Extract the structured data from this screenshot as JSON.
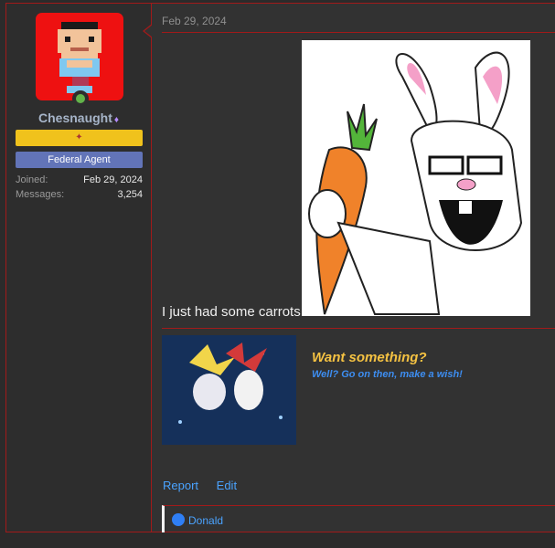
{
  "post": {
    "date": "Feb 29, 2024",
    "message": "I just had some carrots"
  },
  "user": {
    "name": "Chesnaught",
    "title_banner": "Federal Agent",
    "joined_label": "Joined:",
    "joined_value": "Feb 29, 2024",
    "messages_label": "Messages:",
    "messages_value": "3,254"
  },
  "signature": {
    "headline": "Want something?",
    "subline": "Well? Go on then, make a wish!"
  },
  "actions": {
    "report": "Report",
    "edit": "Edit"
  },
  "reactions": {
    "user": "Donald"
  },
  "colors": {
    "border": "#a11a1a",
    "link": "#4aa3ff",
    "avatar_bg": "#ee1111",
    "banner_yellow": "#f0c21c",
    "banner_agent": "#6274b8",
    "sig_title": "#f5c242",
    "sig_sub": "#3d8ef2"
  },
  "icons": [
    "online-status-icon",
    "gem-icon",
    "like-reaction-icon"
  ]
}
